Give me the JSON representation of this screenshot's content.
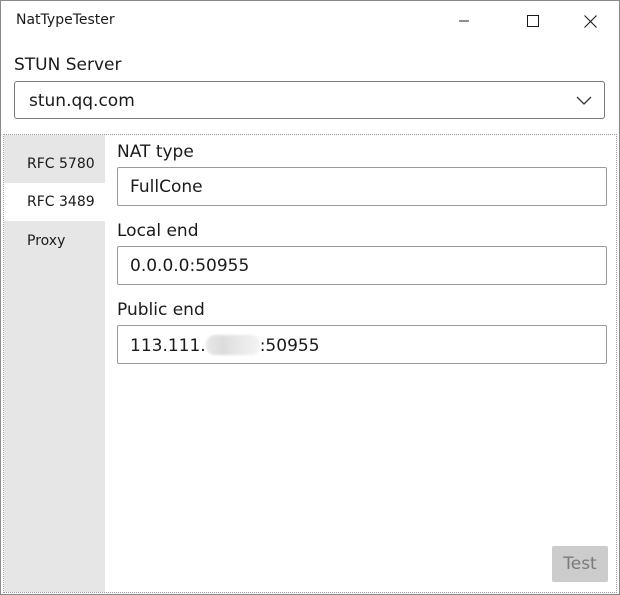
{
  "window": {
    "title": "NatTypeTester"
  },
  "stun": {
    "label": "STUN Server",
    "value": "stun.qq.com"
  },
  "tabs": [
    {
      "label": "RFC 5780",
      "selected": false
    },
    {
      "label": "RFC 3489",
      "selected": true
    },
    {
      "label": "Proxy",
      "selected": false
    }
  ],
  "fields": {
    "nat_type": {
      "label": "NAT type",
      "value": "FullCone"
    },
    "local_end": {
      "label": "Local end",
      "value": "0.0.0.0:50955"
    },
    "public_end": {
      "label": "Public end",
      "value_prefix": "113.111.",
      "value_suffix": ":50955"
    }
  },
  "actions": {
    "test_label": "Test",
    "test_enabled": false
  },
  "icons": {
    "minimize": "minimize-icon",
    "maximize": "maximize-icon",
    "close": "close-icon",
    "dropdown": "chevron-down-icon"
  },
  "colors": {
    "tab_strip": "#e6e6e6",
    "disabled_button": "#cccccc",
    "border": "#7a7a7a"
  }
}
